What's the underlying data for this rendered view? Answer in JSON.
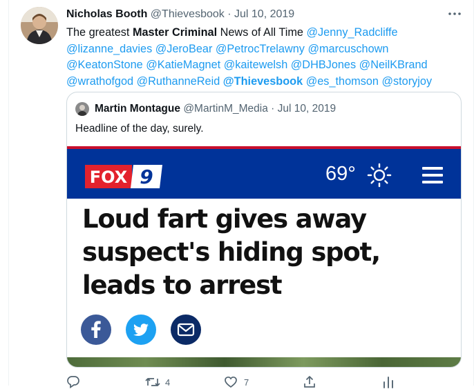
{
  "tweet": {
    "author_name": "Nicholas Booth",
    "author_handle": "@Thievesbook",
    "separator": "·",
    "date": "Jul 10, 2019",
    "text_segments": [
      {
        "type": "text",
        "value": "The greatest "
      },
      {
        "type": "bold",
        "value": "Master Criminal"
      },
      {
        "type": "text",
        "value": " News of All Time "
      },
      {
        "type": "mention",
        "value": "@Jenny_Radcliffe"
      },
      {
        "type": "text",
        "value": " "
      },
      {
        "type": "mention",
        "value": "@lizanne_davies"
      },
      {
        "type": "text",
        "value": " "
      },
      {
        "type": "mention",
        "value": "@JeroBear"
      },
      {
        "type": "text",
        "value": " "
      },
      {
        "type": "mention",
        "value": "@PetrocTrelawny"
      },
      {
        "type": "text",
        "value": " "
      },
      {
        "type": "mention",
        "value": "@marcuschown"
      },
      {
        "type": "text",
        "value": " "
      },
      {
        "type": "mention",
        "value": "@KeatonStone"
      },
      {
        "type": "text",
        "value": " "
      },
      {
        "type": "mention",
        "value": "@KatieMagnet"
      },
      {
        "type": "text",
        "value": " "
      },
      {
        "type": "mention",
        "value": "@kaitewelsh"
      },
      {
        "type": "text",
        "value": " "
      },
      {
        "type": "mention",
        "value": "@DHBJones"
      },
      {
        "type": "text",
        "value": " "
      },
      {
        "type": "mention",
        "value": "@NeilKBrand"
      },
      {
        "type": "text",
        "value": " "
      },
      {
        "type": "mention",
        "value": "@wrathofgod"
      },
      {
        "type": "text",
        "value": " "
      },
      {
        "type": "mention",
        "value": "@RuthanneReid"
      },
      {
        "type": "text",
        "value": " "
      },
      {
        "type": "mention-bold",
        "value": "@Thievesbook"
      },
      {
        "type": "text",
        "value": " "
      },
      {
        "type": "mention",
        "value": "@es_thomson"
      },
      {
        "type": "text",
        "value": " "
      },
      {
        "type": "mention",
        "value": "@storyjoy"
      }
    ]
  },
  "quote": {
    "author_name": "Martin Montague",
    "author_handle": "@MartinM_Media",
    "separator": "·",
    "date": "Jul 10, 2019",
    "text": "Headline of the day, surely.",
    "media": {
      "logo_text_fox": "FOX",
      "logo_text_9": "9",
      "temperature": "69°",
      "headline": "Loud fart gives away suspect's hiding spot, leads to arrest",
      "share_icons": [
        "facebook-icon",
        "twitter-icon",
        "mail-icon"
      ]
    }
  },
  "actions": {
    "reply_count": "",
    "retweet_count": "4",
    "like_count": "7",
    "share_count": "",
    "analytics_count": ""
  },
  "colors": {
    "link": "#1d9bf0",
    "fox_nav": "#003399",
    "fox_red": "#c8102e"
  }
}
